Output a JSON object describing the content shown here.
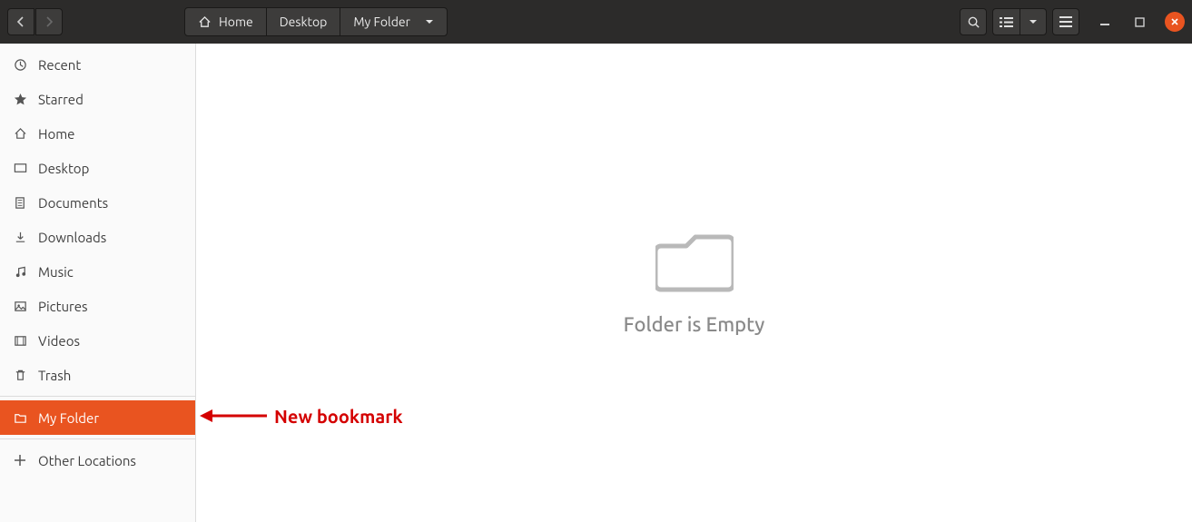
{
  "breadcrumb": {
    "home": "Home",
    "desktop": "Desktop",
    "current": "My Folder"
  },
  "sidebar": {
    "items": [
      {
        "label": "Recent"
      },
      {
        "label": "Starred"
      },
      {
        "label": "Home"
      },
      {
        "label": "Desktop"
      },
      {
        "label": "Documents"
      },
      {
        "label": "Downloads"
      },
      {
        "label": "Music"
      },
      {
        "label": "Pictures"
      },
      {
        "label": "Videos"
      },
      {
        "label": "Trash"
      }
    ],
    "bookmark": {
      "label": "My Folder"
    },
    "other": {
      "label": "Other Locations"
    }
  },
  "main": {
    "empty_text": "Folder is Empty"
  },
  "annotation": {
    "text": "New bookmark"
  }
}
